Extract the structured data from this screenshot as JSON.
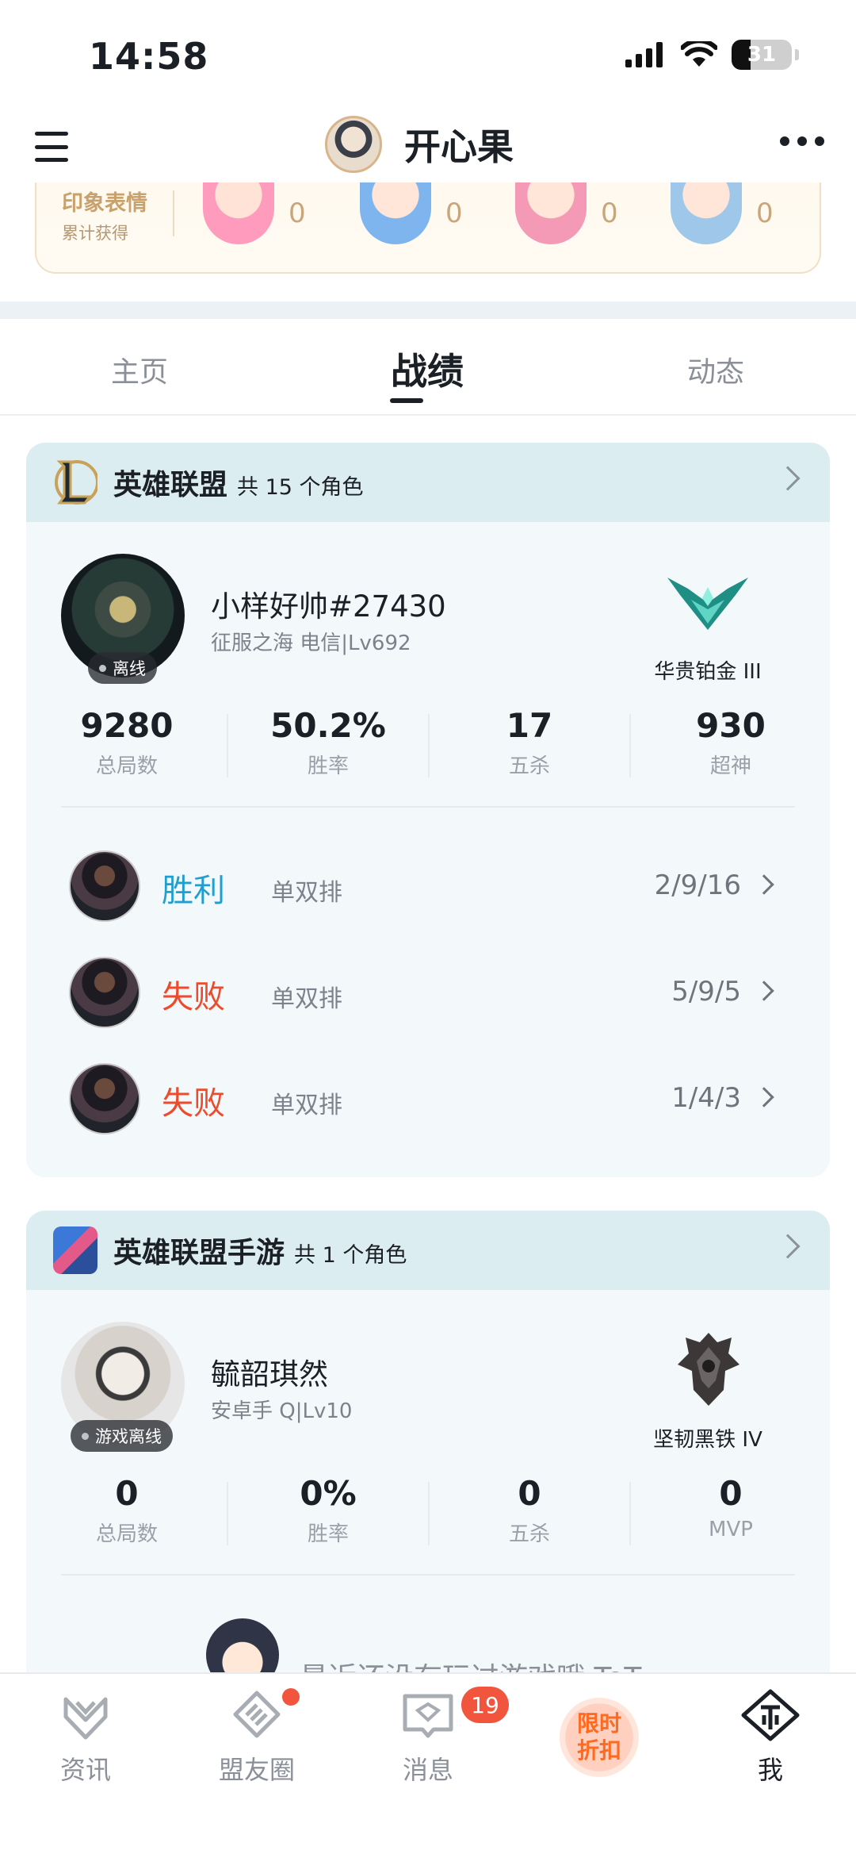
{
  "status_bar": {
    "time": "14:58",
    "battery": "31"
  },
  "header": {
    "title": "开心果"
  },
  "emotes": {
    "title": "印象表情",
    "subtitle": "累计获得",
    "items": [
      {
        "name": "pink-hair-emote",
        "count": "0"
      },
      {
        "name": "blue-hair-emote",
        "count": "0"
      },
      {
        "name": "heart-emote",
        "count": "0"
      },
      {
        "name": "gg-emote",
        "count": "0"
      }
    ]
  },
  "tabs": [
    {
      "label": "主页"
    },
    {
      "label": "战绩"
    },
    {
      "label": "动态"
    }
  ],
  "lol": {
    "title": "英雄联盟",
    "count": "共 15 个角色",
    "player": {
      "name": "小样好帅#27430",
      "sub": "征服之海 电信|Lv692",
      "status": "离线",
      "rank": "华贵铂金 III"
    },
    "stats": [
      {
        "value": "9280",
        "label": "总局数"
      },
      {
        "value": "50.2%",
        "label": "胜率"
      },
      {
        "value": "17",
        "label": "五杀"
      },
      {
        "value": "930",
        "label": "超神"
      }
    ],
    "matches": [
      {
        "result": "胜利",
        "mode": "单双排",
        "kda": "2/9/16",
        "color": "#1f9fd0"
      },
      {
        "result": "失败",
        "mode": "单双排",
        "kda": "5/9/5",
        "color": "#ee4a2c"
      },
      {
        "result": "失败",
        "mode": "单双排",
        "kda": "1/4/3",
        "color": "#ee4a2c"
      }
    ]
  },
  "mobile": {
    "title": "英雄联盟手游",
    "count": "共 1 个角色",
    "player": {
      "name": "毓韶琪然",
      "sub": "安卓手 Q|Lv10",
      "status": "游戏离线",
      "rank": "坚韧黑铁 IV"
    },
    "stats": [
      {
        "value": "0",
        "label": "总局数"
      },
      {
        "value": "0%",
        "label": "胜率"
      },
      {
        "value": "0",
        "label": "五杀"
      },
      {
        "value": "0",
        "label": "MVP"
      }
    ],
    "empty_text": "最近还没有玩过游戏哦 ToT"
  },
  "nav": {
    "items": [
      {
        "label": "资讯"
      },
      {
        "label": "盟友圈"
      },
      {
        "label": "消息"
      },
      {
        "label": "我"
      }
    ],
    "messages_badge": "19",
    "promo_line1": "限时",
    "promo_line2": "折扣"
  },
  "colors": {
    "win": "#1f9fd0",
    "loss": "#ee4a2c",
    "accent": "#ff6a21"
  }
}
